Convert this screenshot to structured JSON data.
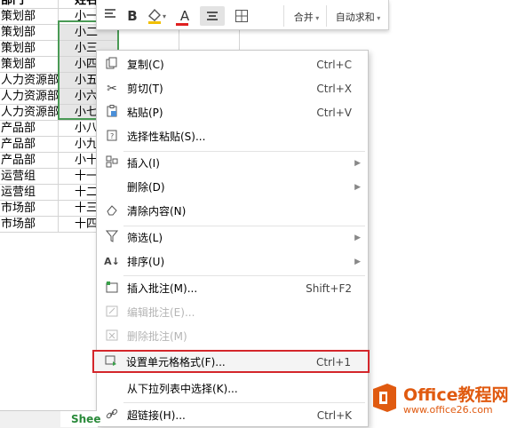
{
  "sheet": {
    "header": {
      "department": "部门",
      "name": "姓名"
    },
    "rows": [
      {
        "department": "策划部",
        "name": "小一"
      },
      {
        "department": "策划部",
        "name": "小二"
      },
      {
        "department": "策划部",
        "name": "小三"
      },
      {
        "department": "策划部",
        "name": "小四"
      },
      {
        "department": "人力资源部",
        "name": "小五"
      },
      {
        "department": "人力资源部",
        "name": "小六"
      },
      {
        "department": "人力资源部",
        "name": "小七"
      },
      {
        "department": "产品部",
        "name": "小八"
      },
      {
        "department": "产品部",
        "name": "小九"
      },
      {
        "department": "产品部",
        "name": "小十"
      },
      {
        "department": "运营组",
        "name": "十一"
      },
      {
        "department": "运营组",
        "name": "十二"
      },
      {
        "department": "市场部",
        "name": "十三"
      },
      {
        "department": "市场部",
        "name": "十四"
      }
    ],
    "tab_label": "Shee"
  },
  "mini_toolbar": {
    "bold": "B",
    "font_color": "A",
    "merge_label": "合并",
    "autosum_label": "自动求和"
  },
  "context_menu": {
    "items": [
      {
        "label": "复制(C)",
        "shortcut": "Ctrl+C",
        "icon": "copy-icon"
      },
      {
        "label": "剪切(T)",
        "shortcut": "Ctrl+X",
        "icon": "scissors-icon"
      },
      {
        "label": "粘贴(P)",
        "shortcut": "Ctrl+V",
        "icon": "paste-icon"
      },
      {
        "label": "选择性粘贴(S)...",
        "shortcut": "",
        "icon": "paste-special-icon"
      },
      {
        "label": "插入(I)",
        "shortcut": "",
        "icon": "insert-icon",
        "submenu": true
      },
      {
        "label": "删除(D)",
        "shortcut": "",
        "icon": "",
        "submenu": true
      },
      {
        "label": "清除内容(N)",
        "shortcut": "",
        "icon": "eraser-icon"
      },
      {
        "label": "筛选(L)",
        "shortcut": "",
        "icon": "filter-icon",
        "submenu": true
      },
      {
        "label": "排序(U)",
        "shortcut": "",
        "icon": "sort-icon",
        "submenu": true
      },
      {
        "label": "插入批注(M)...",
        "shortcut": "Shift+F2",
        "icon": "insert-comment-icon"
      },
      {
        "label": "编辑批注(E)...",
        "shortcut": "",
        "icon": "edit-comment-icon",
        "disabled": true
      },
      {
        "label": "删除批注(M)",
        "shortcut": "",
        "icon": "delete-comment-icon",
        "disabled": true
      },
      {
        "label": "设置单元格格式(F)...",
        "shortcut": "Ctrl+1",
        "icon": "format-cells-icon",
        "highlighted": true
      },
      {
        "label": "从下拉列表中选择(K)...",
        "shortcut": "",
        "icon": ""
      },
      {
        "label": "超链接(H)...",
        "shortcut": "Ctrl+K",
        "icon": "link-icon"
      }
    ]
  },
  "watermark": {
    "title": "Office教程网",
    "url": "www.office26.com"
  },
  "colors": {
    "selection_border": "#4a9a55",
    "highlight_border": "#d4262b",
    "watermark": "#e05a10"
  }
}
